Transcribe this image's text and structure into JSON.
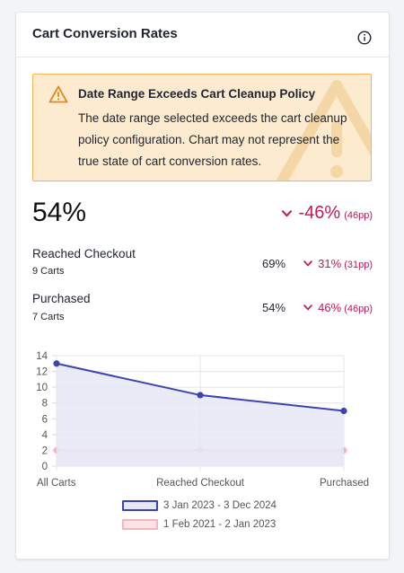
{
  "card": {
    "title": "Cart Conversion Rates",
    "info_icon": "info-circle-icon"
  },
  "alert": {
    "title": "Date Range Exceeds Cart Cleanup Policy",
    "body": "The date range selected exceeds the cart cleanup policy configuration. Chart may not represent the true state of cart conversion rates.",
    "icon": "warning-triangle-icon"
  },
  "summary": {
    "value": "54%",
    "delta": "-46%",
    "delta_pp": "(46pp)",
    "delta_color": "#c0195a"
  },
  "metrics": [
    {
      "label": "Reached Checkout",
      "sub": "9 Carts",
      "value": "69%",
      "delta": "31%",
      "delta_pp": "(31pp)"
    },
    {
      "label": "Purchased",
      "sub": "7 Carts",
      "value": "54%",
      "delta": "46%",
      "delta_pp": "(46pp)"
    }
  ],
  "chart_data": {
    "type": "line",
    "categories": [
      "All Carts",
      "Reached Checkout",
      "Purchased"
    ],
    "ylim": [
      0,
      14
    ],
    "yticks": [
      0,
      2,
      4,
      6,
      8,
      10,
      12,
      14
    ],
    "grid": true,
    "legend_position": "bottom",
    "series": [
      {
        "name": "3 Jan 2023 - 3 Dec 2024",
        "values": [
          13,
          9,
          7
        ],
        "color": "#3b45b0",
        "fill": "#e6e7f6"
      },
      {
        "name": "1 Feb 2021 - 2 Jan 2023",
        "values": [
          2,
          2,
          2
        ],
        "color": "#f0b8be",
        "fill": "#fbe4e6"
      }
    ]
  }
}
